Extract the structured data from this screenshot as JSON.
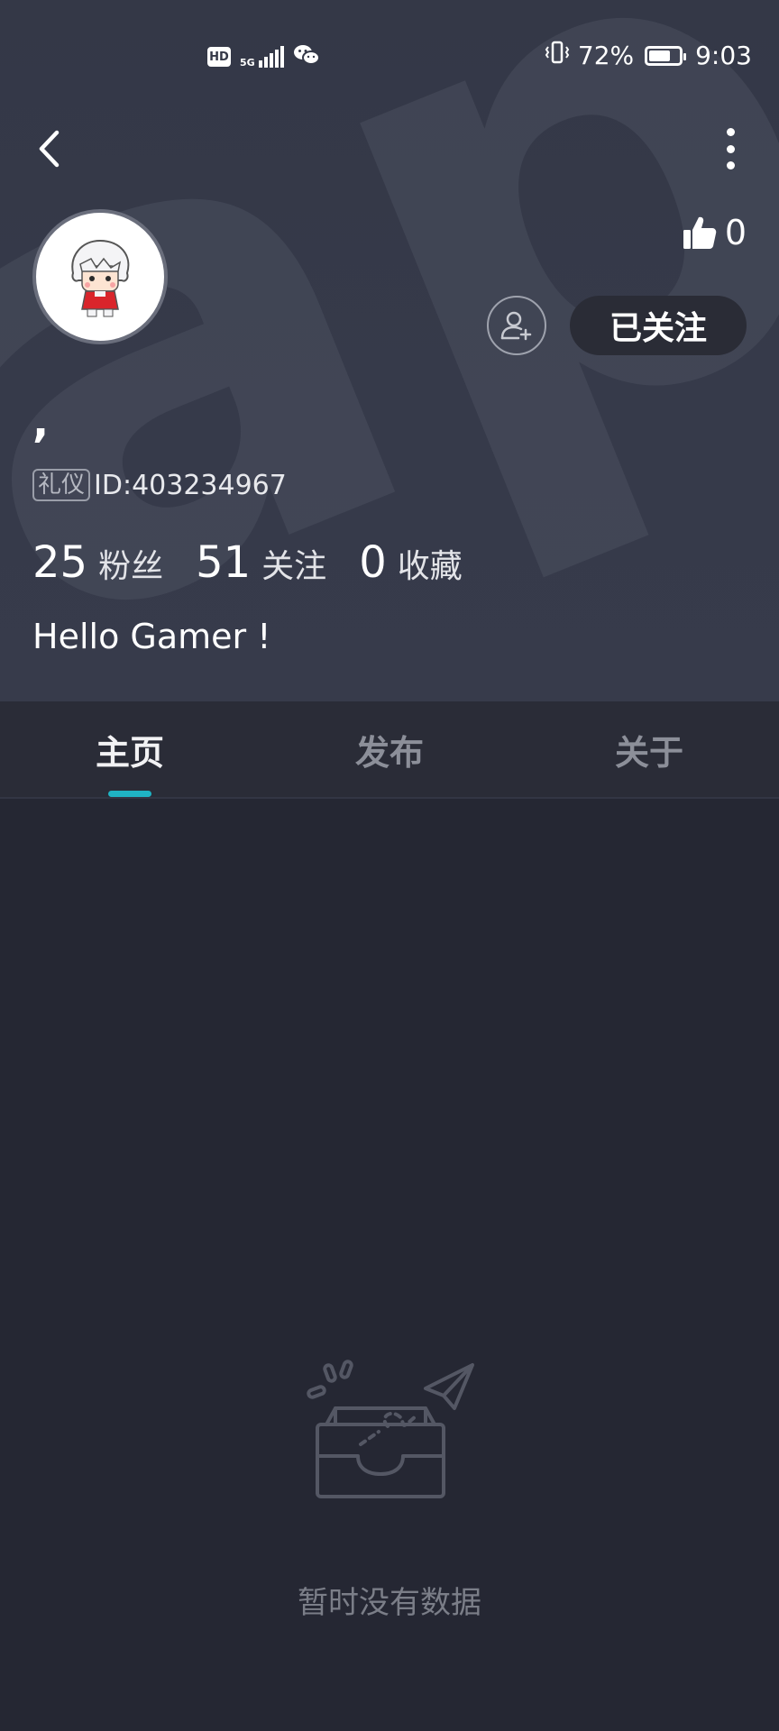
{
  "status_bar": {
    "hd_label": "HD",
    "network": "5G",
    "battery_percent": "72%",
    "battery_level": 0.72,
    "time": "9:03"
  },
  "watermark": "apTa",
  "profile": {
    "likes_count": "0",
    "follow_state_label": "已关注",
    "nickname": ",",
    "tag": "礼仪",
    "id_text": "ID:403234967",
    "stats": [
      {
        "value": "25",
        "label": "粉丝"
      },
      {
        "value": "51",
        "label": "关注"
      },
      {
        "value": "0",
        "label": "收藏"
      }
    ],
    "bio": "Hello Gamer !"
  },
  "tabs": [
    {
      "label": "主页",
      "active": true
    },
    {
      "label": "发布",
      "active": false
    },
    {
      "label": "关于",
      "active": false
    }
  ],
  "empty_state": {
    "message": "暂时没有数据"
  },
  "colors": {
    "header_bg": "#343847",
    "page_bg": "#252733",
    "tab_indicator": "#1fb3c4",
    "followed_button_bg": "#2a2c36"
  },
  "icons": [
    "back-arrow-icon",
    "more-vertical-icon",
    "thumbs-up-icon",
    "add-user-icon",
    "empty-inbox-icon",
    "paper-plane-icon"
  ]
}
